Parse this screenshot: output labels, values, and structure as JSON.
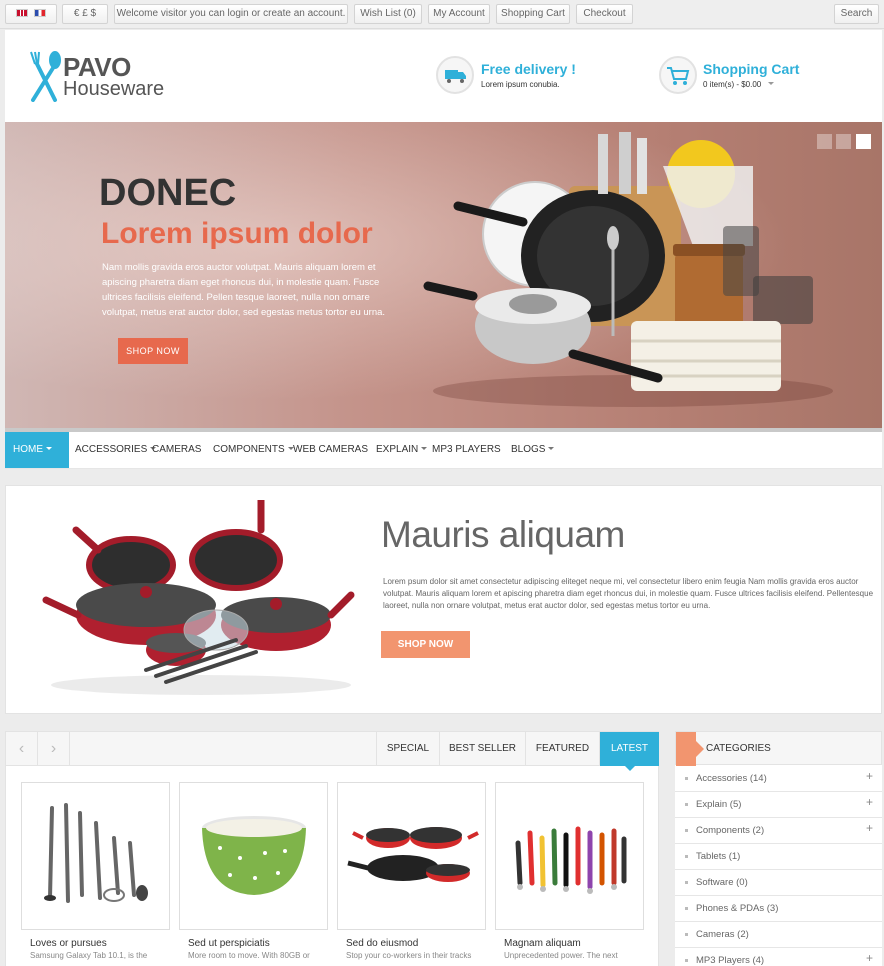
{
  "topbar": {
    "currency": "€ £ $",
    "welcome": "Welcome visitor you can login or create an account.",
    "wishlist": "Wish List (0)",
    "account": "My Account",
    "cart": "Shopping Cart",
    "checkout": "Checkout",
    "search": "Search",
    "languages": [
      "english-flag-icon",
      "french-flag-icon"
    ]
  },
  "header": {
    "logo_word1": "PAVO",
    "logo_word2": "Houseware",
    "delivery_title": "Free delivery !",
    "delivery_sub": "Lorem ipsum conubia.",
    "cart_title": "Shopping Cart",
    "cart_sub": "0 item(s) - $0.00"
  },
  "slider": {
    "title": "DONEC",
    "subtitle": "Lorem ipsum dolor",
    "text": "Nam mollis gravida eros auctor volutpat. Mauris aliquam lorem et apiscing pharetra diam eget rhoncus dui, in molestie quam. Fusce ultrices facilisis eleifend. Pellen tesque laoreet, nulla non ornare volutpat, metus erat auctor dolor, sed egestas metus tortor eu urna.",
    "button": "SHOP NOW",
    "active_dot": 3
  },
  "menu": {
    "items": [
      {
        "label": "HOME",
        "dropdown": true,
        "active": true
      },
      {
        "label": "ACCESSORIES",
        "dropdown": true
      },
      {
        "label": "CAMERAS",
        "dropdown": false
      },
      {
        "label": "COMPONENTS",
        "dropdown": true
      },
      {
        "label": "WEB CAMERAS",
        "dropdown": false
      },
      {
        "label": "EXPLAIN",
        "dropdown": true
      },
      {
        "label": "MP3 PLAYERS",
        "dropdown": false
      },
      {
        "label": "BLOGS",
        "dropdown": true
      }
    ]
  },
  "feature": {
    "title": "Mauris aliquam",
    "text": "Lorem psum dolor sit amet consectetur adipiscing eliteget neque mi, vel consectetur libero enim  feugia Nam mollis gravida eros auctor volutpat. Mauris aliquam lorem et apiscing pharetra diam  eget rhoncus  dui, in molestie quam. Fusce ultrices facilisis eleifend. Pellentesque laoreet, nulla non ornare volutpat, metus erat auctor dolor, sed egestas metus tortor eu urna.",
    "button": "SHOP NOW"
  },
  "products": {
    "tabs": [
      "SPECIAL",
      "BEST SELLER",
      "FEATURED",
      "LATEST"
    ],
    "active_tab": "LATEST",
    "items": [
      {
        "name": "Loves or pursues",
        "desc": "Samsung Galaxy Tab 10.1, is the"
      },
      {
        "name": "Sed ut perspiciatis",
        "desc": "More room to move. With 80GB or"
      },
      {
        "name": "Sed do eiusmod",
        "desc": "Stop your co-workers in their tracks"
      },
      {
        "name": "Magnam aliquam",
        "desc": "Unprecedented power. The next"
      }
    ]
  },
  "categories": {
    "title": "CATEGORIES",
    "items": [
      {
        "label": "Accessories (14)",
        "expand": "+"
      },
      {
        "label": "Explain (5)",
        "expand": "+"
      },
      {
        "label": "Components (2)",
        "expand": "+"
      },
      {
        "label": "Tablets (1)",
        "expand": ""
      },
      {
        "label": "Software (0)",
        "expand": ""
      },
      {
        "label": "Phones & PDAs (3)",
        "expand": ""
      },
      {
        "label": "Cameras (2)",
        "expand": ""
      },
      {
        "label": "MP3 Players (4)",
        "expand": "+"
      }
    ]
  },
  "colors": {
    "accent_blue": "#2fb0d9",
    "accent_orange": "#e7694d",
    "button_orange": "#f2956f"
  }
}
